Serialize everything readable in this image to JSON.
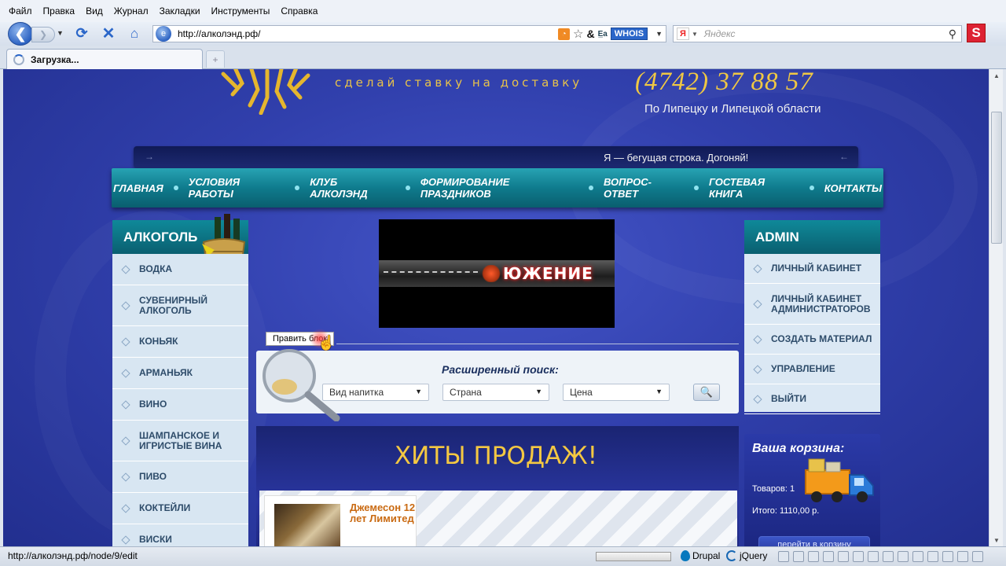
{
  "browser": {
    "menu": [
      "Файл",
      "Правка",
      "Вид",
      "Журнал",
      "Закладки",
      "Инструменты",
      "Справка"
    ],
    "url": "http://алколэнд.рф/",
    "whois": "WHOIS",
    "search_placeholder": "Яндекс",
    "yandex_letter": "Я",
    "addon_letter": "S",
    "tab_title": "Загрузка...",
    "status_url": "http://алколэнд.рф/node/9/edit",
    "status_drupal": "Drupal",
    "status_jquery": "jQuery"
  },
  "site": {
    "tagline": "сделай ставку на доставку",
    "phone": "(4742) 37 88 57",
    "region": "По Липецку и Липецкой области",
    "ticker": "Я — бегущая строка. Догоняй!",
    "nav": [
      "Главная",
      "Условия работы",
      "Клуб алколэнд",
      "Формирование праздников",
      "Вопрос-ответ",
      "Гостевая книга",
      "Контакты"
    ],
    "left_sidebar": {
      "title": "АЛКОГОЛЬ",
      "items": [
        "Водка",
        "Сувенирный алкоголь",
        "Коньяк",
        "Арманьяк",
        "Вино",
        "Шампанское и игристые вина",
        "Пиво",
        "Коктейли",
        "Виски"
      ]
    },
    "banner_word": "ЮЖЕНИЕ",
    "edit_block": "Править блок",
    "search": {
      "title": "Расширенный поиск:",
      "selects": [
        "Вид напитка",
        "Страна",
        "Цена"
      ]
    },
    "hits": {
      "title": "ХИТЫ ПРОДАЖ!",
      "product_name": "Джемесон 12 лет Лимитед"
    },
    "admin": {
      "title": "ADMIN",
      "items": [
        "Личный кабинет",
        "Личный кабинет администраторов",
        "Создать материал",
        "Управление",
        "Выйти"
      ]
    },
    "cart": {
      "title": "Ваша корзина:",
      "items": "Товаров: 1",
      "total": "Итого: 1110,00 р.",
      "button": "перейти в корзину"
    }
  },
  "colors": {
    "page_bg": "#3140ad",
    "nav_teal": "#0f7b8d",
    "gold": "#f0c843",
    "sidebar_bg": "#dbe8f4"
  }
}
